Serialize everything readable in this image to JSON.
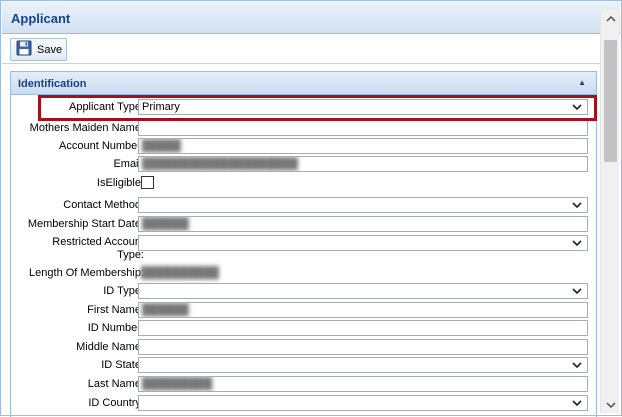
{
  "panel": {
    "title": "Applicant"
  },
  "toolbar": {
    "save_label": "Save"
  },
  "section": {
    "title": "Identification"
  },
  "fields": {
    "applicant_type": {
      "label": "Applicant Type:",
      "value": "Primary"
    },
    "mothers_maiden_name": {
      "label": "Mothers Maiden Name:",
      "value": ""
    },
    "account_number": {
      "label": "Account Number:",
      "value": "█████"
    },
    "email": {
      "label": "Email:",
      "value": "████████████████████"
    },
    "is_eligible": {
      "label": "IsEligible:"
    },
    "contact_method": {
      "label": "Contact Method:",
      "value": ""
    },
    "membership_start_date": {
      "label": "Membership Start Date:",
      "value": "██████"
    },
    "restricted_account_type_l1": "Restricted Account",
    "restricted_account_type_l2": "Type:",
    "length_of_membership": {
      "label": "Length Of Membership:",
      "value": "██████████"
    },
    "id_type": {
      "label": "ID Type:",
      "value": ""
    },
    "first_name": {
      "label": "First Name:",
      "value": "██████"
    },
    "id_number": {
      "label": "ID Number:",
      "value": ""
    },
    "middle_name": {
      "label": "Middle Name:",
      "value": ""
    },
    "id_state": {
      "label": "ID State:",
      "value": ""
    },
    "last_name": {
      "label": "Last Name:",
      "value": "█████████"
    },
    "id_country": {
      "label": "ID Country:",
      "value": ""
    }
  }
}
